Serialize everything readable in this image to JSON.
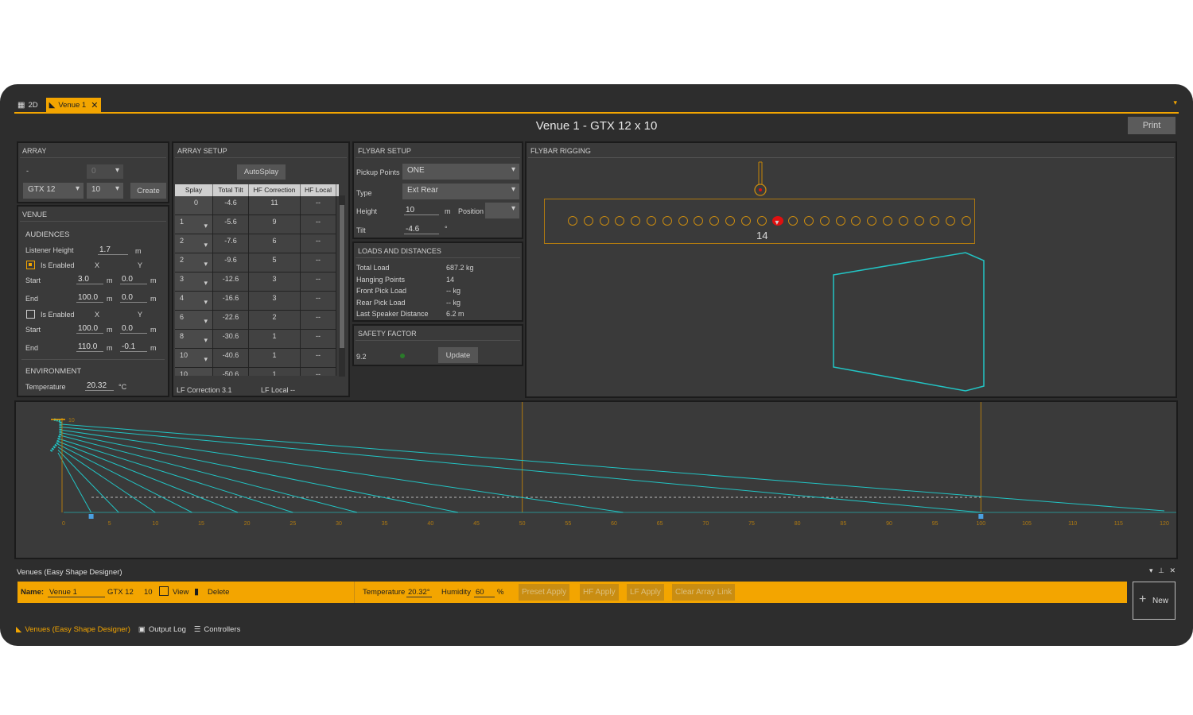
{
  "tabs": [
    {
      "label": "2D",
      "icon": "chart-icon"
    },
    {
      "label": "Venue 1",
      "icon": "speaker-icon"
    }
  ],
  "title": "Venue 1  - GTX 12 x 10",
  "print_label": "Print",
  "array": {
    "header": "ARRAY",
    "dash": "-",
    "disabled_value": "0",
    "model": "GTX 12",
    "count": "10",
    "create_label": "Create"
  },
  "venue": {
    "header": "VENUE",
    "audiences_label": "AUDIENCES",
    "listener_height_label": "Listener Height",
    "listener_height": "1.7",
    "unit_m": "m",
    "aud1": {
      "enabled_label": "Is Enabled",
      "start_x": "3.0",
      "start_y": "0.0",
      "end_x": "100.0",
      "end_y": "0.0"
    },
    "aud2": {
      "enabled_label": "Is Enabled",
      "start_x": "100.0",
      "start_y": "0.0",
      "end_x": "110.0",
      "end_y": "-0.1"
    },
    "x_label": "X",
    "y_label": "Y",
    "start_label": "Start",
    "end_label": "End",
    "environment_label": "ENVIRONMENT",
    "temperature_label": "Temperature",
    "temperature": "20.32",
    "temp_unit": "°C"
  },
  "array_setup": {
    "header": "ARRAY SETUP",
    "autosplay_label": "AutoSplay",
    "columns": [
      "Splay",
      "Total Tilt",
      "HF Correction",
      "HF Local"
    ],
    "rows": [
      {
        "splay": "0",
        "tilt": "-4.6",
        "hf": "11",
        "local": "--"
      },
      {
        "splay": "1",
        "tilt": "-5.6",
        "hf": "9",
        "local": "--"
      },
      {
        "splay": "2",
        "tilt": "-7.6",
        "hf": "6",
        "local": "--"
      },
      {
        "splay": "2",
        "tilt": "-9.6",
        "hf": "5",
        "local": "--"
      },
      {
        "splay": "3",
        "tilt": "-12.6",
        "hf": "3",
        "local": "--"
      },
      {
        "splay": "4",
        "tilt": "-16.6",
        "hf": "3",
        "local": "--"
      },
      {
        "splay": "6",
        "tilt": "-22.6",
        "hf": "2",
        "local": "--"
      },
      {
        "splay": "8",
        "tilt": "-30.6",
        "hf": "1",
        "local": "--"
      },
      {
        "splay": "10",
        "tilt": "-40.6",
        "hf": "1",
        "local": "--"
      },
      {
        "splay": "10",
        "tilt": "-50.6",
        "hf": "1",
        "local": "--"
      }
    ],
    "lf_correction": "LF Correction 3.1",
    "lf_local": "LF Local --"
  },
  "flybar_setup": {
    "header": "FLYBAR SETUP",
    "pickup_label": "Pickup Points",
    "pickup": "ONE",
    "type_label": "Type",
    "type": "Ext Rear",
    "height_label": "Height",
    "height": "10",
    "height_unit": "m",
    "position_label": "Position",
    "tilt_label": "Tilt",
    "tilt": "-4.6",
    "tilt_unit": "°"
  },
  "loads": {
    "header": "LOADS AND DISTANCES",
    "items": [
      {
        "label": "Total Load",
        "value": "687.2 kg"
      },
      {
        "label": "Hanging Points",
        "value": "14"
      },
      {
        "label": "Front Pick Load",
        "value": "-- kg"
      },
      {
        "label": "Rear Pick Load",
        "value": "-- kg"
      },
      {
        "label": "Last Speaker Distance",
        "value": "6.2 m"
      }
    ]
  },
  "safety": {
    "header": "SAFETY FACTOR",
    "value": "9.2",
    "update_label": "Update"
  },
  "rigging": {
    "header": "FLYBAR RIGGING",
    "hole_count": 26,
    "selected_hole": 13,
    "selected_label": "14"
  },
  "side_view": {
    "array_label": "10",
    "x_ticks": [
      "0",
      "5",
      "10",
      "15",
      "20",
      "25",
      "30",
      "35",
      "40",
      "45",
      "50",
      "55",
      "60",
      "65",
      "70",
      "75",
      "80",
      "85",
      "90",
      "95",
      "100",
      "105",
      "110",
      "115",
      "120"
    ],
    "x_max": 120,
    "audience_start": 3,
    "audience_end": 100,
    "ray_ends": [
      120,
      100,
      61,
      43,
      32,
      25,
      19,
      14,
      10,
      6,
      3
    ],
    "colors": {
      "rays": "#22c4c4",
      "grid": "#b07a10",
      "accent": "#f3a500"
    }
  },
  "venues_panel": {
    "header": "Venues (Easy Shape Designer)",
    "name_label": "Name:",
    "name": "Venue 1",
    "model": "GTX 12",
    "count": "10",
    "view_label": "View",
    "delete_label": "Delete",
    "temperature_label": "Temperature",
    "temperature": "20.32°",
    "humidity_label": "Humidity",
    "humidity": "60",
    "humidity_unit": "%",
    "buttons": [
      "Preset Apply",
      "HF Apply",
      "LF Apply",
      "Clear Array Link"
    ],
    "new_label": "New"
  },
  "status_tabs": [
    "Venues (Easy Shape Designer)",
    "Output Log",
    "Controllers"
  ]
}
